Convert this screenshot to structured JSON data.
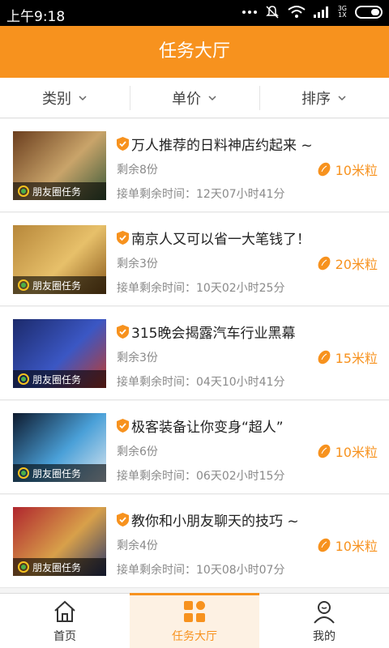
{
  "status_bar": {
    "time": "上午9:18",
    "network_label_top": "3G",
    "network_label_bottom": "1X"
  },
  "header": {
    "title": "任务大厅"
  },
  "filters": [
    {
      "label": "类别"
    },
    {
      "label": "单价"
    },
    {
      "label": "排序"
    }
  ],
  "tasks": [
    {
      "title": "万人推荐的日料神店约起来 ~",
      "remain": "剩余8份",
      "deadline": "接单剩余时间：12天07小时41分",
      "reward": "10米粒",
      "tag": "朋友圈任务",
      "thumb_colors": [
        "#6b3e1e",
        "#c9a46a",
        "#3b5a3a"
      ]
    },
    {
      "title": "南京人又可以省一大笔钱了！",
      "remain": "剩余3份",
      "deadline": "接单剩余时间：10天02小时25分",
      "reward": "20米粒",
      "tag": "朋友圈任务",
      "thumb_colors": [
        "#b7873a",
        "#e7c06a",
        "#8a5a1c"
      ]
    },
    {
      "title": "315晚会揭露汽车行业黑幕",
      "remain": "剩余3份",
      "deadline": "接单剩余时间：04天10小时41分",
      "reward": "15米粒",
      "tag": "朋友圈任务",
      "thumb_colors": [
        "#1c2a6b",
        "#3b57c4",
        "#c23b2b"
      ]
    },
    {
      "title": "极客装备让你变身“超人”",
      "remain": "剩余6份",
      "deadline": "接单剩余时间：06天02小时15分",
      "reward": "10米粒",
      "tag": "朋友圈任务",
      "thumb_colors": [
        "#0e1a2e",
        "#4aa0d8",
        "#d8e4ee"
      ]
    },
    {
      "title": "教你和小朋友聊天的技巧 ~",
      "remain": "剩余4份",
      "deadline": "接单剩余时间：10天08小时07分",
      "reward": "10米粒",
      "tag": "朋友圈任务",
      "thumb_colors": [
        "#b0262e",
        "#d8a04a",
        "#2e3a6a"
      ]
    }
  ],
  "tabbar": [
    {
      "label": "首页",
      "icon": "home-icon"
    },
    {
      "label": "任务大厅",
      "icon": "grid-icon",
      "active": true
    },
    {
      "label": "我的",
      "icon": "user-icon"
    }
  ],
  "colors": {
    "accent": "#f7921e",
    "text": "#222222",
    "muted": "#8a8a8a"
  }
}
